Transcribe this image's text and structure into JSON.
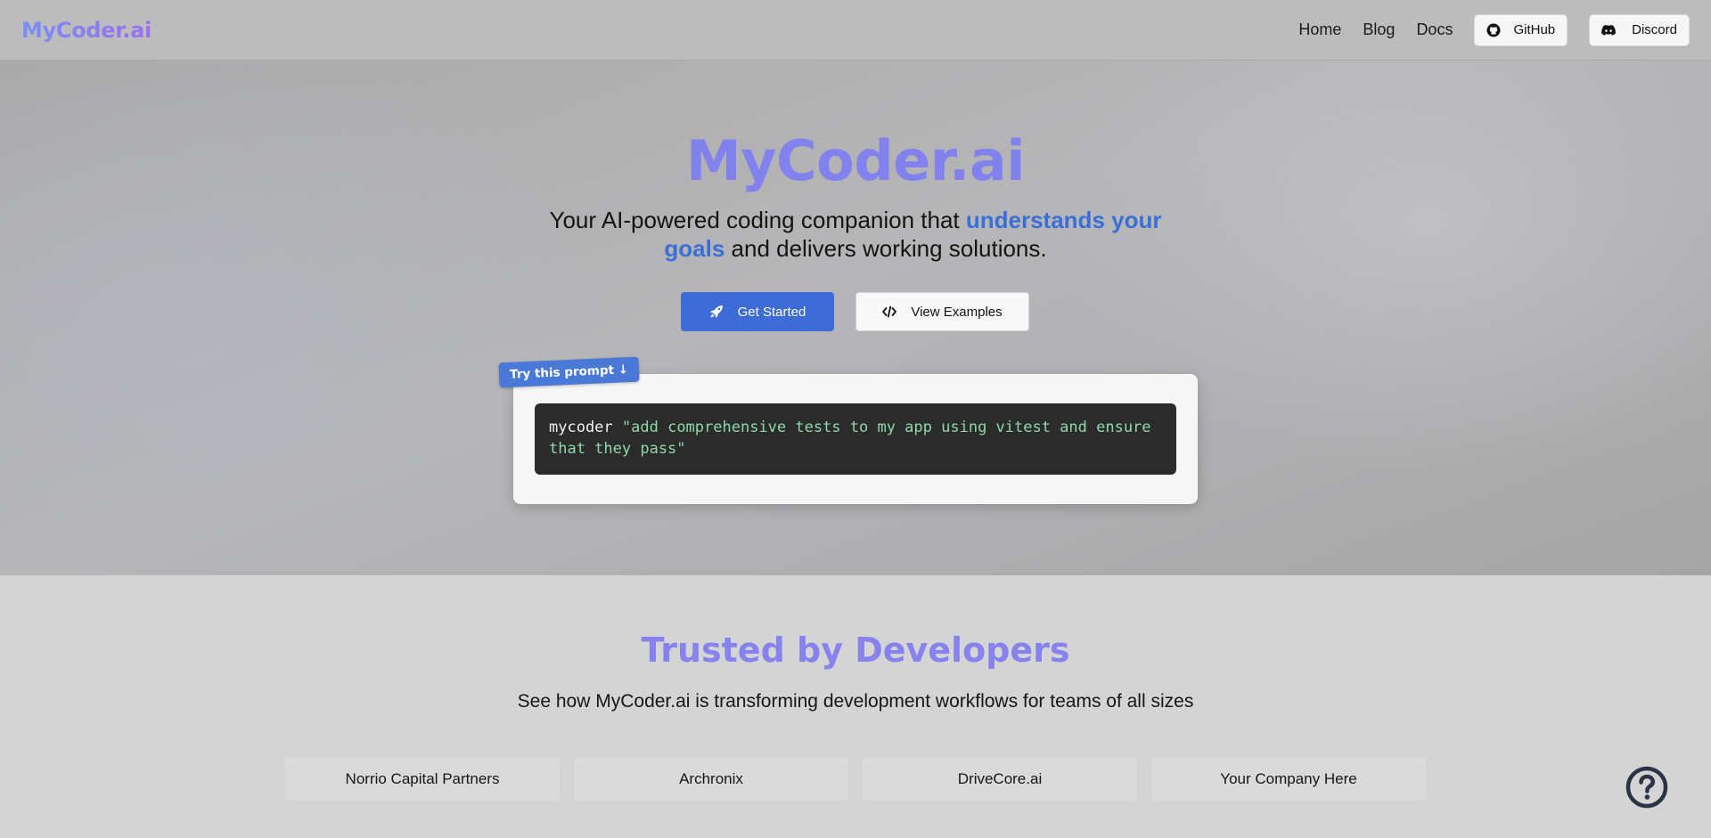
{
  "navbar": {
    "logo": "MyCoder.ai",
    "links": [
      "Home",
      "Blog",
      "Docs"
    ],
    "github_label": "GitHub",
    "discord_label": "Discord"
  },
  "hero": {
    "title": "MyCoder.ai",
    "subtitle_pre": "Your AI-powered coding companion that ",
    "subtitle_highlight": "understands your goals",
    "subtitle_post": " and delivers working solutions.",
    "get_started_label": "Get Started",
    "view_examples_label": "View Examples",
    "prompt_tag": "Try this prompt ↓",
    "prompt_command": "mycoder",
    "prompt_string": "\"add comprehensive tests to my app using vitest and ensure that they pass\""
  },
  "trusted": {
    "title": "Trusted by Developers",
    "subtitle": "See how MyCoder.ai is transforming development workflows for teams of all sizes",
    "companies": [
      "Norrio Capital Partners",
      "Archronix",
      "DriveCore.ai",
      "Your Company Here"
    ]
  },
  "colors": {
    "accent_blue": "#3d6cd6",
    "title_purple": "#8282ee",
    "code_string_green": "#8fd8a8"
  },
  "icons": {
    "github": "github-icon",
    "discord": "discord-icon",
    "rocket": "rocket-icon",
    "code": "code-icon",
    "help": "question-circle-icon"
  }
}
